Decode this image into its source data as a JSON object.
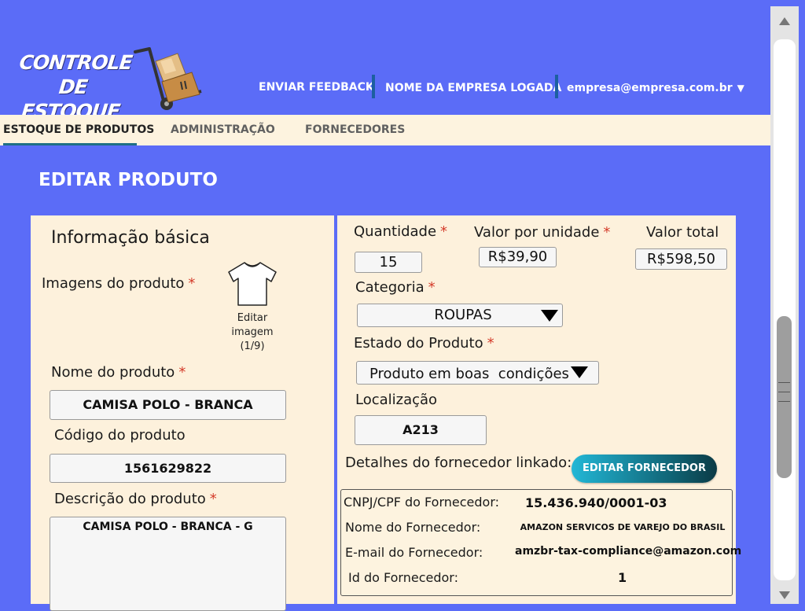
{
  "header": {
    "logo_text": "CONTROLE DE ESTOQUE",
    "feedback_link": "ENVIAR FEEDBACK",
    "company_name": "NOME DA EMPRESA LOGADA",
    "user_email": "empresa@empresa.com.br",
    "user_caret": "▼"
  },
  "tabs": [
    {
      "label": "ESTOQUE DE PRODUTOS",
      "active": true
    },
    {
      "label": "ADMINISTRAÇÃO",
      "active": false
    },
    {
      "label": "FORNECEDORES",
      "active": false
    }
  ],
  "page_title": "EDITAR PRODUTO",
  "left": {
    "section_title": "Informação básica",
    "images_label": "Imagens do produto",
    "required_mark": "*",
    "edit_image_label": "Editar imagem (1/9)",
    "name_label": "Nome do produto",
    "name_value": "CAMISA POLO - BRANCA",
    "code_label": "Código do produto",
    "code_value": "1561629822",
    "description_label": "Descrição do produto",
    "description_value": "CAMISA POLO - BRANCA - G"
  },
  "right": {
    "quantity_label": "Quantidade",
    "quantity_value": "15",
    "unit_price_label": "Valor por unidade",
    "unit_price_value": "R$39,90",
    "total_label": "Valor total",
    "total_value": "R$598,50",
    "category_label": "Categoria",
    "category_value": "ROUPAS",
    "state_label": "Estado  do Produto",
    "state_value": "Produto em boas  condições",
    "location_label": "Localização",
    "location_value": "A213",
    "supplier_details_label": "Detalhes do fornecedor linkado:",
    "edit_supplier_button": "EDITAR FORNECEDOR"
  },
  "supplier": {
    "cnpj_label": "CNPJ/CPF do Fornecedor:",
    "cnpj_value": "15.436.940/0001-03",
    "name_label": "Nome do Fornecedor:",
    "name_value": "AMAZON SERVICOS DE VAREJO DO BRASIL",
    "email_label": "E-mail do Fornecedor:",
    "email_value": "amzbr-tax-compliance@amazon.com",
    "id_label": "Id do Fornecedor:",
    "id_value": "1"
  },
  "colors": {
    "background": "#5b6cf7",
    "panel": "#fdf1dc",
    "required": "#d43b2a",
    "tab_underline": "#1f6f85",
    "button_start": "#22b7d6",
    "button_end": "#0b3a45"
  },
  "icons": [
    "hand-truck-boxes-icon",
    "tshirt-icon",
    "chevron-down-icon",
    "scroll-up-icon",
    "scroll-down-icon"
  ]
}
